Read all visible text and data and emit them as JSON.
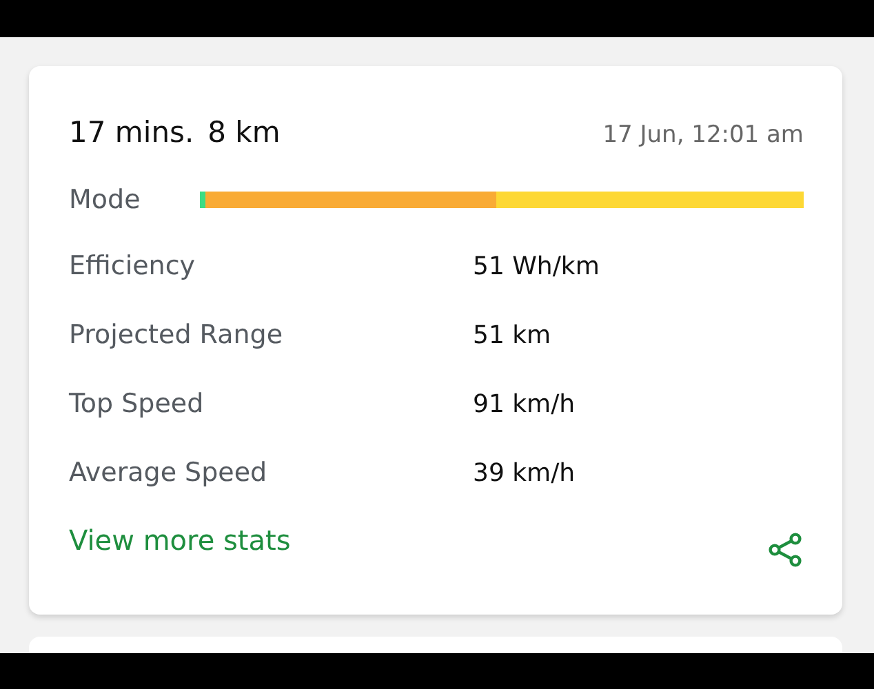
{
  "trip": {
    "duration": "17 mins.",
    "distance": "8 km",
    "date": "17 Jun, 12:01 am"
  },
  "mode": {
    "label": "Mode",
    "segments": [
      {
        "color": "#3ddc84"
      },
      {
        "color": "#f9ab35"
      },
      {
        "color": "#fdd835"
      }
    ]
  },
  "stats": [
    {
      "label": "Efficiency",
      "value": "51 Wh/km"
    },
    {
      "label": "Projected Range",
      "value": "51 km"
    },
    {
      "label": "Top Speed",
      "value": "91 km/h"
    },
    {
      "label": "Average Speed",
      "value": "39 km/h"
    }
  ],
  "link": "View more stats"
}
